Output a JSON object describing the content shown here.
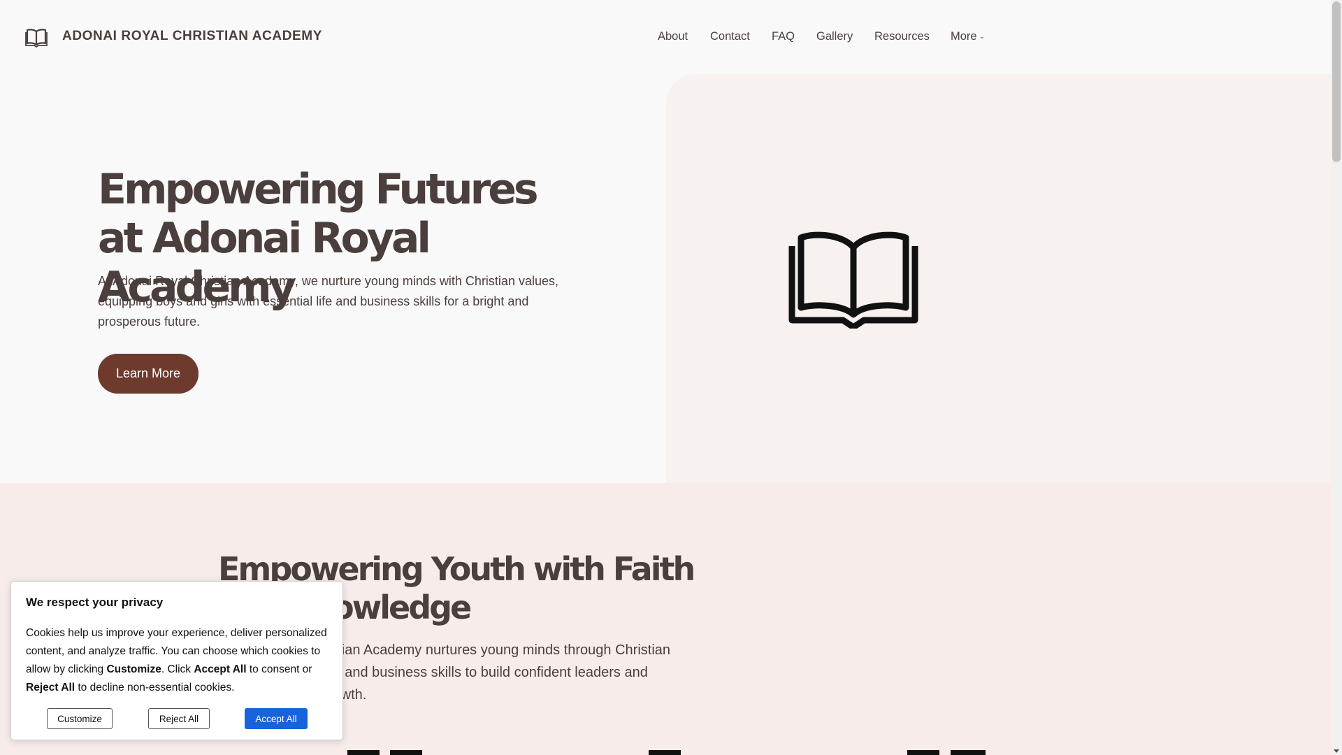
{
  "site": {
    "title": "ADONAI ROYAL CHRISTIAN ACADEMY",
    "logo_icon": "book-icon"
  },
  "nav": {
    "items": [
      {
        "label": "About"
      },
      {
        "label": "Contact"
      },
      {
        "label": "FAQ"
      },
      {
        "label": "Gallery"
      },
      {
        "label": "Resources"
      },
      {
        "label": "More"
      }
    ],
    "more_chevron": "⌄"
  },
  "hero": {
    "title": "Empowering Futures at Adonai Royal Academy",
    "text": "At Adonai Royal Christian Academy, we nurture young minds with Christian values, equipping boys and girls with essential life and business skills for a bright and prosperous future.",
    "button_label": "Learn More",
    "image_icon": "open-book-icon"
  },
  "section2": {
    "title": "Empowering Youth with Faith and Knowledge",
    "text": "Adonai Royal Christian Academy nurtures young minds through Christian values, teaching life and business skills to build confident leaders and support spiritual growth."
  },
  "cookie": {
    "title": "We respect your privacy",
    "text_parts": [
      "Cookies help us improve your experience, deliver personalized content, and analyze traffic. You can choose which cookies to allow by clicking ",
      "Customize",
      ". Click ",
      "Accept All",
      " to consent or ",
      "Reject All",
      " to decline non-essential cookies."
    ],
    "customize_label": "Customize",
    "reject_label": "Reject All",
    "accept_label": "Accept All"
  },
  "colors": {
    "text": "#4a3f3c",
    "accent_button": "#6e3a2e",
    "hero_right_bg": "#f7f1f0",
    "section2_bg": "#f7ecea",
    "cookie_primary": "#1863dc"
  }
}
